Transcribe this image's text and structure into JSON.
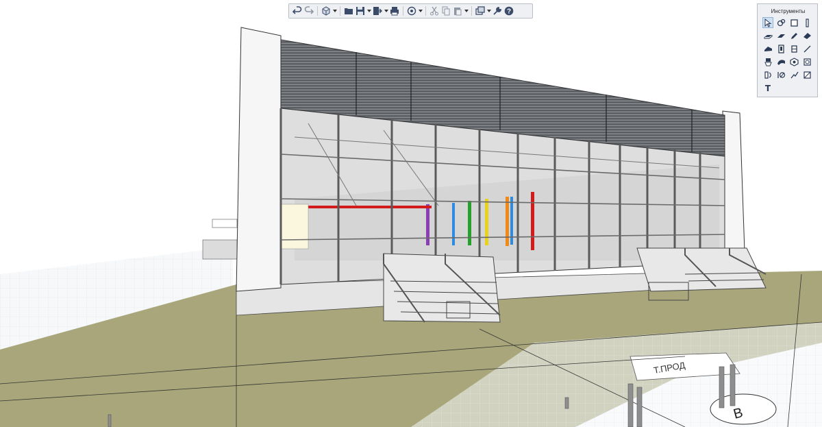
{
  "toolbar": {
    "buttons": [
      {
        "icon": "undo-icon"
      },
      {
        "icon": "redo-icon"
      },
      {
        "icon": "view-cube-icon"
      },
      {
        "icon": "open-folder-icon"
      },
      {
        "icon": "save-icon"
      },
      {
        "icon": "export-icon"
      },
      {
        "icon": "print-icon"
      },
      {
        "icon": "navigation-icon"
      },
      {
        "icon": "cut-icon"
      },
      {
        "icon": "copy-icon"
      },
      {
        "icon": "paste-icon"
      },
      {
        "icon": "layers-icon"
      },
      {
        "icon": "wrench-icon"
      },
      {
        "icon": "help-icon"
      }
    ],
    "help_glyph": "?"
  },
  "tools_panel": {
    "title": "Инструменты",
    "items": [
      "select-arrow-icon",
      "selection-fence-icon",
      "door-opening-icon",
      "column-icon",
      "slab-icon",
      "wall-icon",
      "pencil-icon",
      "eraser-icon",
      "roof-icon",
      "door-icon",
      "window-icon",
      "line-icon",
      "fixture-icon",
      "mesh-icon",
      "object-icon",
      "room-tag-icon",
      "stair-icon",
      "zone-icon",
      "railing-icon",
      "dimension-icon",
      "text-tool-icon"
    ],
    "text_glyph": "T",
    "accent": "#2b3a55"
  },
  "scene": {
    "ground_color": "#a8a67a",
    "sky_color": "#ffffff",
    "grid_color": "#c9d0d8",
    "label_road": "Т.ПРОД",
    "label_b": "В"
  }
}
